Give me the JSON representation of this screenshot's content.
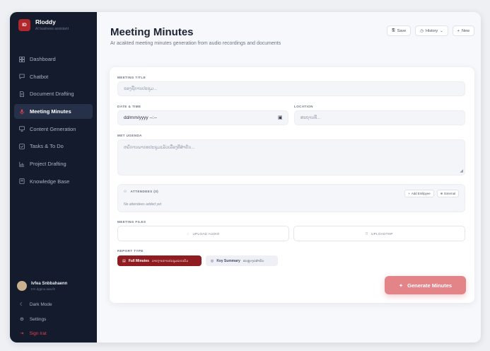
{
  "brand": {
    "name": "Rloddy",
    "subtitle": "AI business assistant",
    "logo_text": "ID"
  },
  "sidebar": {
    "items": [
      {
        "label": "Dashboard",
        "icon": "grid-icon"
      },
      {
        "label": "Chatbot",
        "icon": "chat-icon"
      },
      {
        "label": "Document Drafting",
        "icon": "document-icon"
      },
      {
        "label": "Meeting Minutes",
        "icon": "mic-icon",
        "active": true
      },
      {
        "label": "Content Generation",
        "icon": "monitor-icon"
      },
      {
        "label": "Tasks & To Do",
        "icon": "checkbox-icon"
      },
      {
        "label": "Project Drafting",
        "icon": "chart-icon"
      },
      {
        "label": "Knowledge Base",
        "icon": "book-icon"
      }
    ],
    "user": {
      "name": "Ivfea Snbbahaenn",
      "email": "trm.dgpnu.aaa.fit"
    },
    "dark_mode": "Dark Mode",
    "settings": "Settings",
    "sign_out": "Sign Irat"
  },
  "header": {
    "title": "Meeting Minutes",
    "subtitle": "Ar acakted meeting minutes generation from audio recordings and documents",
    "actions": {
      "save": "Save",
      "history": "History",
      "new": "New"
    }
  },
  "form": {
    "meeting_title": {
      "label": "MEETING TITLE",
      "placeholder": "ຂອງຊື່ການປະຊຸມ..."
    },
    "date_time": {
      "label": "DATE & TIME",
      "value": "dd/mm/yyyy --:--"
    },
    "location": {
      "label": "LOCATION",
      "placeholder": "ສະຖານທີ່..."
    },
    "agenda": {
      "label": "MET UGENDA",
      "placeholder": "ຫຍໍ້ການພາກທປະຊຸມແລ້ວເລື່ອງທີ່ສຳຄັນ..."
    },
    "attendees": {
      "title": "ATTENDEES (0)",
      "empty": "Ne attendees added yet",
      "add_employee": "Add Emílpyee",
      "external": "External"
    },
    "meeting_files": {
      "label": "MEETING FILES",
      "upload_audio": "UPLOAD AUDIO",
      "upload_file": "UPLOADTHP"
    },
    "report_type": {
      "label": "REPORT TYPE",
      "options": [
        {
          "name": "Full Minutes",
          "desc": "ລາຍງານການປະຊຸມແບບເຕັມ",
          "selected": true
        },
        {
          "name": "Key Summary",
          "desc": "ສະຫຼຸບຈຸດສຳຄັນ",
          "selected": false
        }
      ]
    },
    "generate": "Generate Minutes"
  },
  "colors": {
    "sidebar_bg": "#141b2d",
    "accent": "#b2272b",
    "primary_dark": "#8f1c20",
    "generate_button": "#e28488"
  }
}
